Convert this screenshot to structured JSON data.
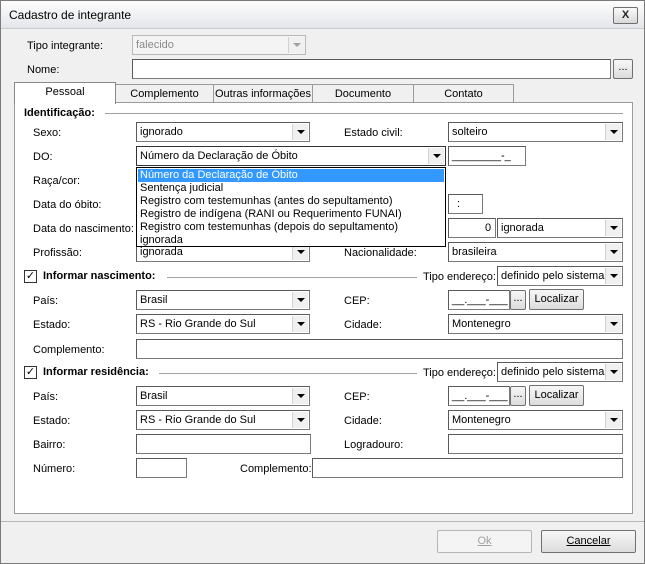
{
  "window": {
    "title": "Cadastro de integrante",
    "close_glyph": "X"
  },
  "top": {
    "tipo_label": "Tipo integrante:",
    "tipo_value": "falecido",
    "nome_label": "Nome:",
    "nome_value": "",
    "ellipsis": "..."
  },
  "tabs": [
    {
      "label": "Pessoal"
    },
    {
      "label": "Complemento"
    },
    {
      "label": "Outras informações"
    },
    {
      "label": "Documento"
    },
    {
      "label": "Contato"
    }
  ],
  "identificacao": {
    "header": "Identificação:",
    "sexo_label": "Sexo:",
    "sexo_value": "ignorado",
    "estado_civil_label": "Estado civil:",
    "estado_civil_value": "solteiro",
    "do_label": "DO:",
    "do_value": "Número da Declaração de Óbito",
    "do_mask": "________-_",
    "raca_label": "Raça/cor:",
    "data_obito_label": "Data do óbito:",
    "hora_mask": ":",
    "data_nasc_label": "Data do nascimento:",
    "idade_value": "0",
    "idade_unit": "ignorada",
    "profissao_label": "Profissão:",
    "profissao_value": "ignorada",
    "nacionalidade_label": "Nacionalidade:",
    "nacionalidade_value": "brasileira"
  },
  "do_options": [
    "Número da Declaração de Óbito",
    "Sentença judicial",
    "Registro com testemunhas (antes do sepultamento)",
    "Registro de indígena (RANI ou Requerimento FUNAI)",
    "Registro com testemunhas (depois do sepultamento)",
    "ignorada"
  ],
  "nascimento": {
    "header": "Informar nascimento:",
    "checked": "✓",
    "tipo_end_label": "Tipo endereço:",
    "tipo_end_value": "definido pelo sistema",
    "pais_label": "País:",
    "pais_value": "Brasil",
    "cep_label": "CEP:",
    "cep_mask": "__.___-___",
    "cep_btn": "...",
    "localizar": "Localizar",
    "estado_label": "Estado:",
    "estado_value": "RS - Rio Grande do Sul",
    "cidade_label": "Cidade:",
    "cidade_value": "Montenegro",
    "complemento_label": "Complemento:"
  },
  "residencia": {
    "header": "Informar residência:",
    "checked": "✓",
    "tipo_end_label": "Tipo endereço:",
    "tipo_end_value": "definido pelo sistema",
    "pais_label": "País:",
    "pais_value": "Brasil",
    "cep_label": "CEP:",
    "cep_mask": "__.___-___",
    "cep_btn": "...",
    "localizar": "Localizar",
    "estado_label": "Estado:",
    "estado_value": "RS - Rio Grande do Sul",
    "cidade_label": "Cidade:",
    "cidade_value": "Montenegro",
    "bairro_label": "Bairro:",
    "logradouro_label": "Logradouro:",
    "numero_label": "Número:",
    "complemento_label": "Complemento:"
  },
  "footer": {
    "ok": "Ok",
    "cancelar": "Cancelar"
  }
}
